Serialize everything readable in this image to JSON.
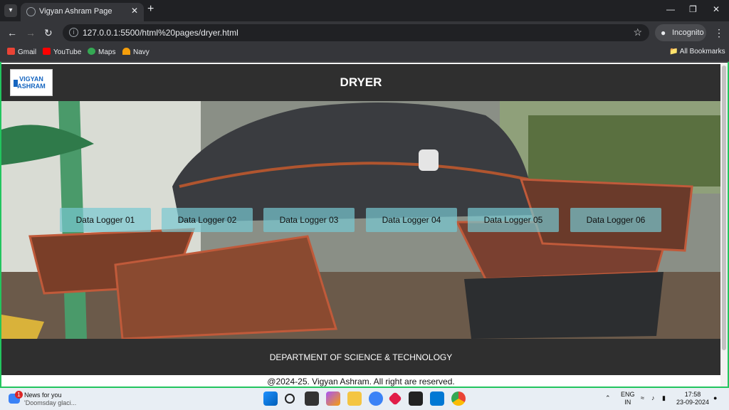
{
  "browser": {
    "tab_title": "Vigyan Ashram Page",
    "url": "127.0.0.1:5500/html%20pages/dryer.html",
    "incognito_label": "Incognito",
    "bookmarks": [
      {
        "label": "Gmail",
        "color": "#ea4335"
      },
      {
        "label": "YouTube",
        "color": "#ff0000"
      },
      {
        "label": "Maps",
        "color": "#34a853"
      },
      {
        "label": "Navy",
        "color": "#f59e0b"
      }
    ],
    "all_bookmarks_label": "All Bookmarks"
  },
  "site": {
    "logo_line1": "VIGYAN",
    "logo_line2": "ASHRAM",
    "title": "DRYER",
    "buttons": [
      "Data Logger 01",
      "Data Logger 02",
      "Data Logger 03",
      "Data Logger 04",
      "Data Logger 05",
      "Data Logger 06"
    ],
    "footer_department": "DEPARTMENT OF SCIENCE & TECHNOLOGY",
    "copyright": "@2024-25. Vigyan Ashram. All right are reserved."
  },
  "taskbar": {
    "news_title": "News for you",
    "news_subtitle": "'Doomsday glaci...",
    "news_badge": "1",
    "lang_line1": "ENG",
    "lang_line2": "IN",
    "time": "17:58",
    "date": "23-09-2024"
  },
  "colors": {
    "header_bg": "#2f2f2f",
    "button_bg": "rgba(120,200,210,0.7)",
    "frame_border": "#22c55e"
  }
}
